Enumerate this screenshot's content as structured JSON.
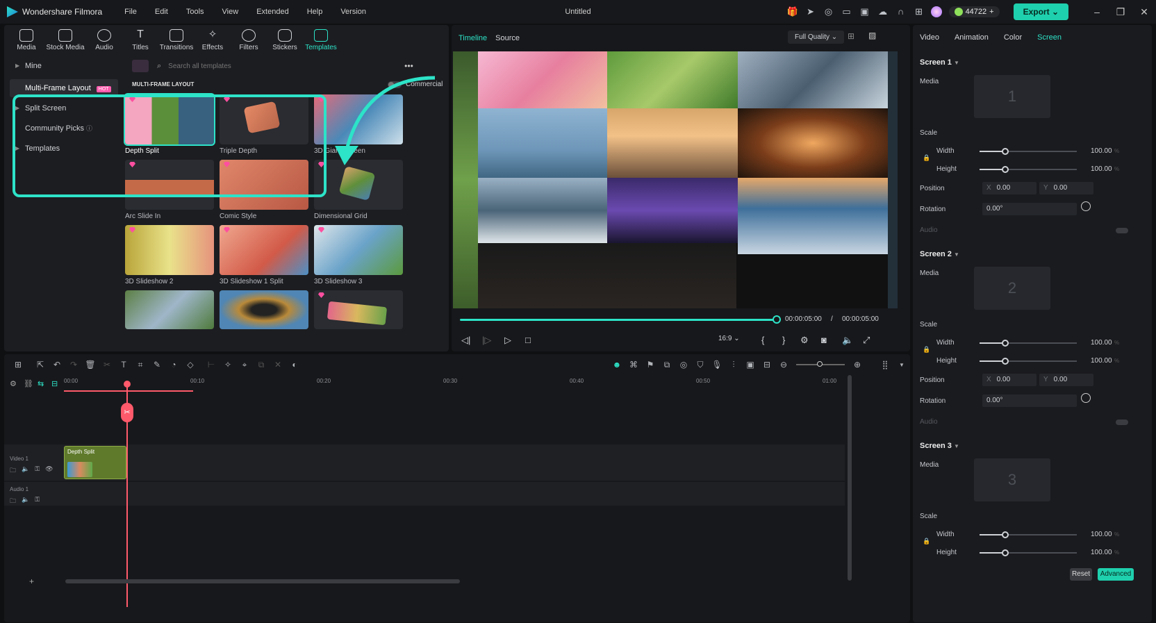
{
  "app": {
    "name": "Wondershare Filmora",
    "document_title": "Untitled",
    "menu": [
      "File",
      "Edit",
      "Tools",
      "View",
      "Extended",
      "Help",
      "Version"
    ],
    "credits": "44722",
    "export_label": "Export"
  },
  "toolbar": {
    "tabs": [
      {
        "label": "Media",
        "icon": "media-icon"
      },
      {
        "label": "Stock Media",
        "icon": "stock-media-icon"
      },
      {
        "label": "Audio",
        "icon": "audio-icon"
      },
      {
        "label": "Titles",
        "icon": "titles-icon"
      },
      {
        "label": "Transitions",
        "icon": "transitions-icon"
      },
      {
        "label": "Effects",
        "icon": "effects-icon"
      },
      {
        "label": "Filters",
        "icon": "filters-icon"
      },
      {
        "label": "Stickers",
        "icon": "stickers-icon"
      },
      {
        "label": "Templates",
        "icon": "templates-icon",
        "active": true
      }
    ]
  },
  "library": {
    "sidebar": [
      {
        "label": "Mine"
      },
      {
        "label": "Multi-Frame Layout",
        "badge": "HOT",
        "selected": true
      },
      {
        "label": "Split Screen"
      },
      {
        "label": "Community Picks"
      },
      {
        "label": "Templates"
      }
    ],
    "search_placeholder": "Search all templates",
    "commercial_label": "Commercial",
    "section_title": "MULTI-FRAME LAYOUT",
    "templates": [
      "Depth Split",
      "Triple Depth",
      "3D Giant Screen",
      "Arc Slide In",
      "Comic Style",
      "Dimensional Grid",
      "3D Slideshow 2",
      "3D Slideshow 1 Split",
      "3D Slideshow 3",
      "",
      "",
      ""
    ]
  },
  "viewer": {
    "tabs": [
      "Timeline",
      "Source"
    ],
    "quality": "Full Quality",
    "current_time": "00:00:05:00",
    "separator": "/",
    "total_time": "00:00:05:00",
    "aspect": "16:9",
    "progress": 1.0
  },
  "properties": {
    "tabs": [
      "Video",
      "Animation",
      "Color",
      "Screen"
    ],
    "screens": [
      {
        "title": "Screen 1",
        "media_number": "1",
        "width": "100.00",
        "height": "100.00",
        "pos_x": "0.00",
        "pos_y": "0.00",
        "rotation": "0.00°"
      },
      {
        "title": "Screen 2",
        "media_number": "2",
        "width": "100.00",
        "height": "100.00",
        "pos_x": "0.00",
        "pos_y": "0.00",
        "rotation": "0.00°"
      },
      {
        "title": "Screen 3",
        "media_number": "3",
        "width": "100.00",
        "height": "100.00"
      }
    ],
    "labels": {
      "media": "Media",
      "scale": "Scale",
      "width": "Width",
      "height": "Height",
      "position": "Position",
      "rotation": "Rotation",
      "audio": "Audio",
      "x": "X",
      "y": "Y",
      "unit": "%"
    },
    "reset_label": "Reset",
    "advanced_label": "Advanced"
  },
  "timeline": {
    "ruler": [
      "00:00",
      "00:10",
      "00:20",
      "00:30",
      "00:40",
      "00:50",
      "01:00"
    ],
    "tracks": [
      {
        "label": "Video 1"
      },
      {
        "label": "Audio 1"
      }
    ],
    "clip_label": "Depth Split"
  },
  "colors": {
    "accent": "#2de3c8",
    "playhead": "#ff5a6b",
    "hot_badge": "#ff5cae"
  }
}
